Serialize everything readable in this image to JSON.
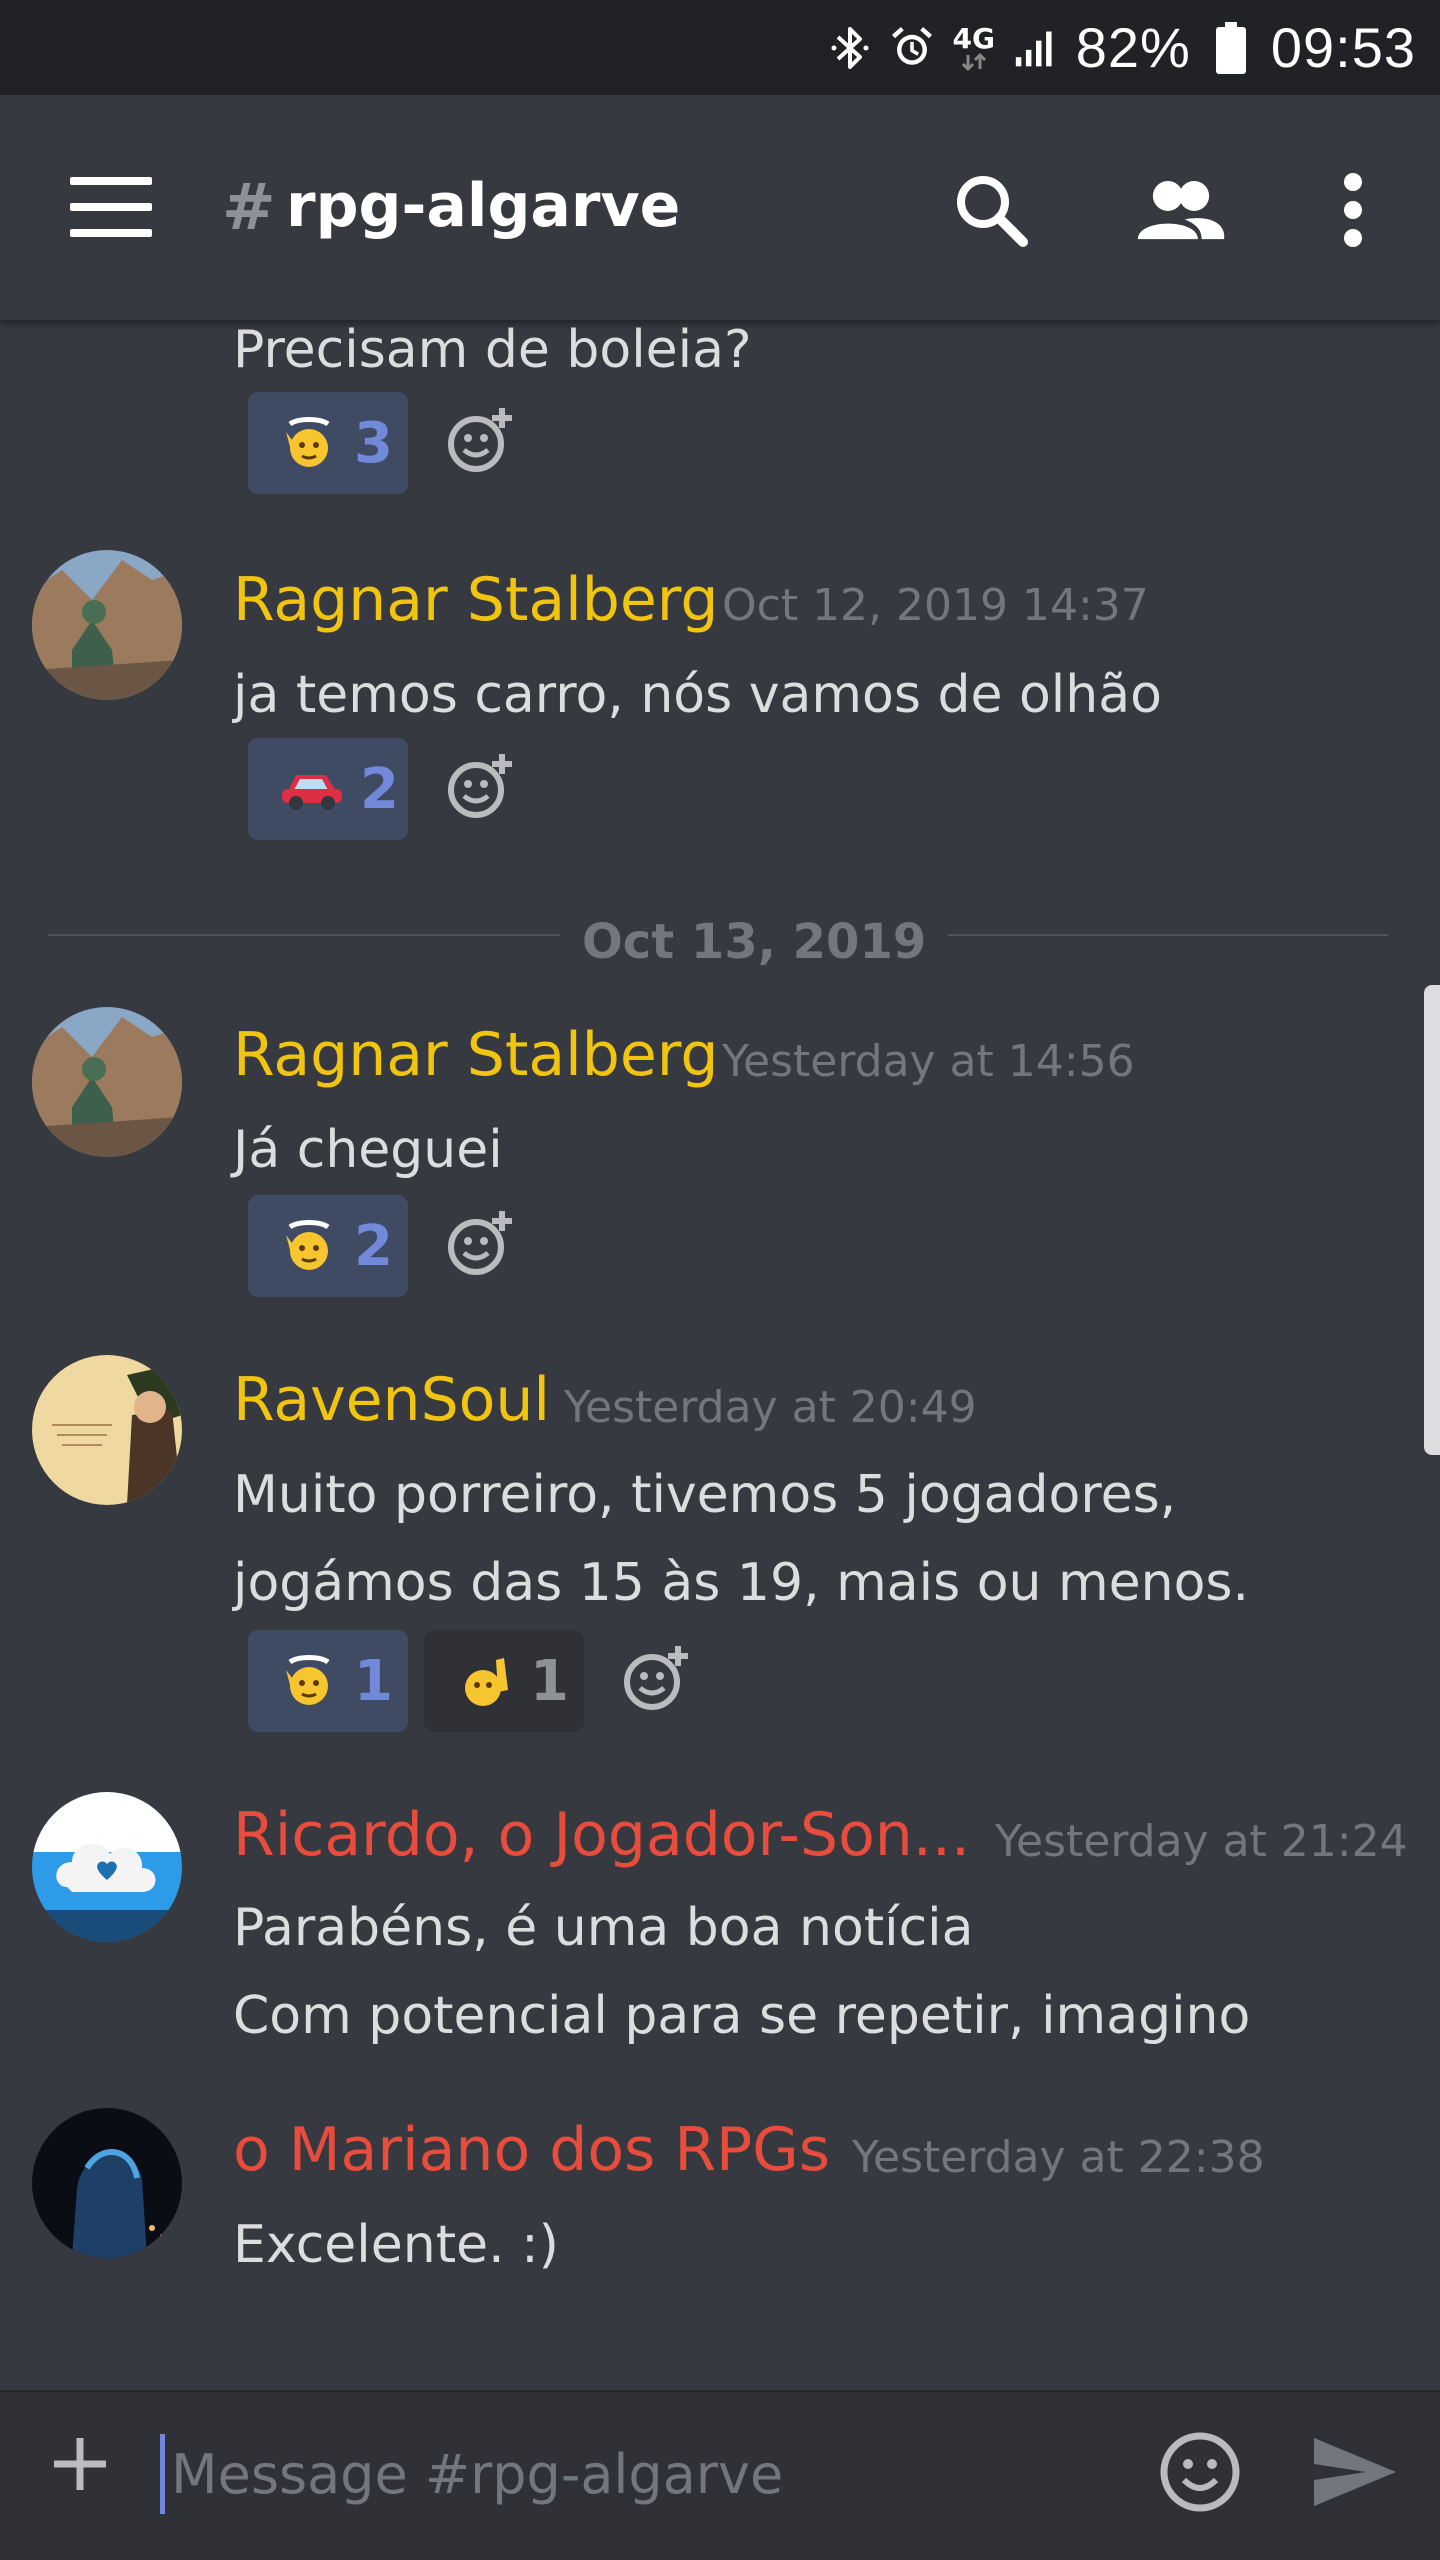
{
  "status_bar": {
    "network": "4G",
    "battery_percent": "82%",
    "time": "09:53",
    "icons": [
      "bluetooth-icon",
      "alarm-icon",
      "network-4g-icon",
      "signal-icon",
      "battery-icon"
    ]
  },
  "header": {
    "hash": "#",
    "channel_name": "rpg-algarve",
    "icons": [
      "menu-icon",
      "search-icon",
      "members-icon",
      "overflow-menu-icon"
    ]
  },
  "colors": {
    "background": "#36393f",
    "header": "#36393f",
    "status_bar": "#202225",
    "composer": "#2f3136",
    "username_gold": "#f1c40f",
    "username_red": "#e74c3c",
    "reaction_me_bg": "#3f4a63",
    "reaction_me_count": "#7289da",
    "timestamp": "#72767d"
  },
  "messages": [
    {
      "text_lines": [
        "Precisam de boleia?"
      ],
      "reactions": [
        {
          "emoji": "raising-hand-emoji",
          "count": "3",
          "me": true
        }
      ]
    },
    {
      "author": "Ragnar Stalberg",
      "author_color": "#f1c40f",
      "timestamp": "Oct 12, 2019 14:37",
      "avatar": "avatar-ragnar",
      "text_lines": [
        "ja temos carro, nós vamos de olhão"
      ],
      "reactions": [
        {
          "emoji": "red-car-emoji",
          "count": "2",
          "me": true
        }
      ]
    },
    {
      "day_divider": "Oct 13, 2019"
    },
    {
      "author": "Ragnar Stalberg",
      "author_color": "#f1c40f",
      "timestamp": "Yesterday at 14:56",
      "avatar": "avatar-ragnar",
      "text_lines": [
        "Já cheguei"
      ],
      "reactions": [
        {
          "emoji": "raising-hand-emoji",
          "count": "2",
          "me": true
        }
      ]
    },
    {
      "author": "RavenSoul",
      "author_color": "#f1c40f",
      "timestamp": "Yesterday at 20:49",
      "avatar": "avatar-ravensoul",
      "text_lines": [
        "Muito porreiro, tivemos 5 jogadores,",
        "jogámos das 15 às 19, mais ou menos."
      ],
      "reactions": [
        {
          "emoji": "raising-hand-emoji",
          "count": "1",
          "me": true
        },
        {
          "emoji": "raised-hand-emoji",
          "count": "1",
          "me": false
        }
      ]
    },
    {
      "author": "Ricardo, o Jogador-Son...",
      "author_color": "#e74c3c",
      "timestamp": "Yesterday at 21:24",
      "avatar": "avatar-ricardo",
      "text_lines": [
        "Parabéns, é uma boa notícia",
        "Com potencial para se repetir, imagino"
      ]
    },
    {
      "author": "o Mariano dos RPGs",
      "author_color": "#e74c3c",
      "timestamp": "Yesterday at 22:38",
      "avatar": "avatar-mariano",
      "text_lines": [
        "Excelente. :)"
      ]
    }
  ],
  "composer": {
    "placeholder": "Message #rpg-algarve",
    "value": "",
    "icons": [
      "add-icon",
      "emoji-icon",
      "send-icon"
    ]
  }
}
